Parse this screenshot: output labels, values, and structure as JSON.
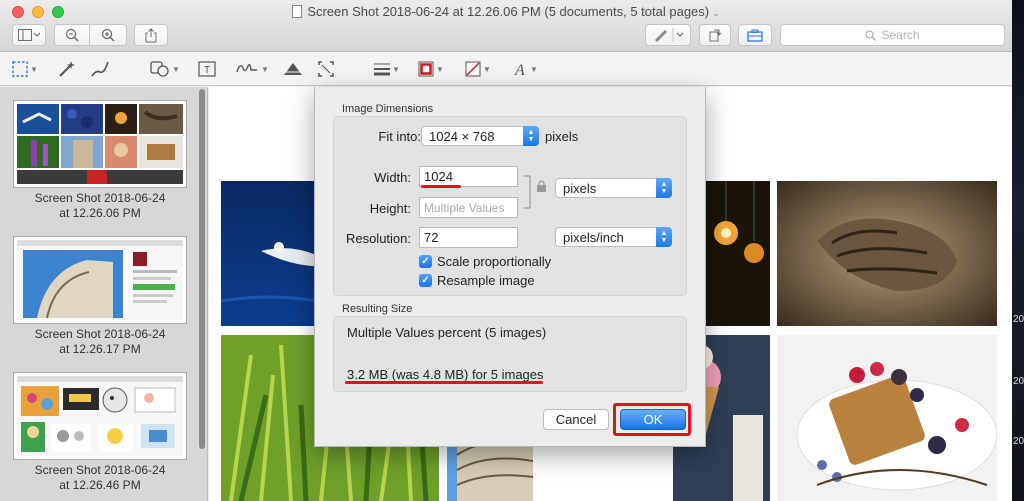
{
  "window": {
    "title": "Screen Shot 2018-06-24 at 12.26.06 PM (5 documents, 5 total pages)",
    "title_chevron": "⌄"
  },
  "toolbar": {
    "search_placeholder": "Search",
    "icons": [
      "sidebar-toggle-icon",
      "zoom-out-icon",
      "zoom-in-icon",
      "share-icon",
      "markup-pen-icon",
      "rotate-icon",
      "toolbox-icon"
    ]
  },
  "markup_tools": [
    "rect-selection-icon",
    "instant-alpha-icon",
    "sketch-icon",
    "shapes-icon",
    "text-icon",
    "sign-icon",
    "adjust-color-icon",
    "crop-icon",
    "line-style-icon",
    "border-color-icon",
    "fill-color-icon",
    "text-style-icon"
  ],
  "sidebar": {
    "items": [
      {
        "caption_line1": "Screen Shot 2018-06-24",
        "caption_line2": "at 12.26.06 PM"
      },
      {
        "caption_line1": "Screen Shot 2018-06-24",
        "caption_line2": "at 12.26.17 PM"
      },
      {
        "caption_line1": "Screen Shot 2018-06-24",
        "caption_line2": "at 12.26.46 PM"
      }
    ]
  },
  "dialog": {
    "image_dimensions_label": "Image Dimensions",
    "fit_into_label": "Fit into:",
    "fit_into_value": "1024 × 768",
    "fit_into_unit": "pixels",
    "width_label": "Width:",
    "width_value": "1024",
    "height_label": "Height:",
    "height_placeholder": "Multiple Values",
    "size_unit": "pixels",
    "resolution_label": "Resolution:",
    "resolution_value": "72",
    "resolution_unit": "pixels/inch",
    "scale_label": "Scale proportionally",
    "scale_checked": true,
    "resample_label": "Resample image",
    "resample_checked": true,
    "resulting_size_label": "Resulting Size",
    "result_percent": "Multiple Values percent (5 images)",
    "result_size": "3.2 MB (was 4.8 MB) for 5 images",
    "cancel_label": "Cancel",
    "ok_label": "OK"
  },
  "colors": {
    "accent": "#1a73e8",
    "highlight_red": "#e0141e"
  }
}
